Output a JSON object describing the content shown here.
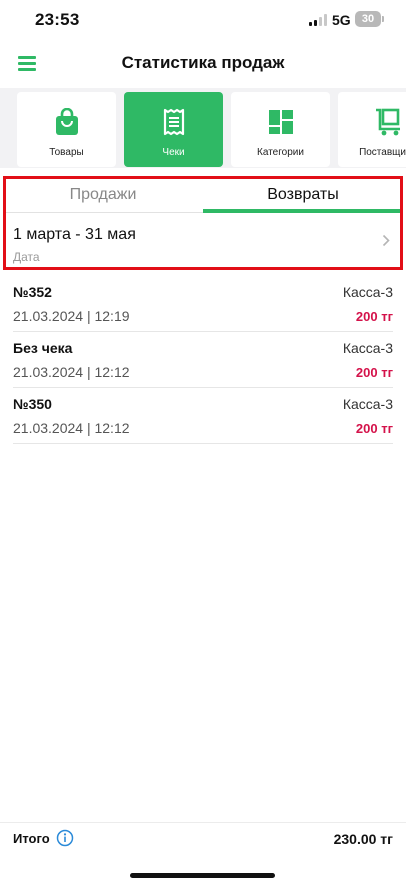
{
  "status_bar": {
    "time": "23:53",
    "network": "5G",
    "battery": "30"
  },
  "header": {
    "title": "Статистика продаж",
    "menu_icon": "hamburger-menu-icon"
  },
  "categories": [
    {
      "label": "Товары",
      "icon": "shopping-bag-icon",
      "active": false
    },
    {
      "label": "Чеки",
      "icon": "receipt-icon",
      "active": true
    },
    {
      "label": "Категории",
      "icon": "category-grid-icon",
      "active": false
    },
    {
      "label": "Поставщики",
      "icon": "supplier-cart-icon",
      "active": false
    }
  ],
  "tabs": {
    "sales": "Продажи",
    "returns": "Возвраты",
    "active": "returns"
  },
  "date_filter": {
    "range": "1 марта - 31 мая",
    "caption": "Дата"
  },
  "receipts": [
    {
      "number": "№352",
      "datetime": "21.03.2024 | 12:19",
      "register": "Касса-3",
      "amount": "200 тг"
    },
    {
      "number": "Без чека",
      "datetime": "21.03.2024 | 12:12",
      "register": "Касса-3",
      "amount": "200 тг"
    },
    {
      "number": "№350",
      "datetime": "21.03.2024 | 12:12",
      "register": "Касса-3",
      "amount": "200 тг"
    }
  ],
  "footer": {
    "total_label": "Итого",
    "total_value": "230.00 тг"
  },
  "colors": {
    "accent": "#2fb965",
    "highlight": "#e20f17",
    "amount": "#d4124a"
  }
}
